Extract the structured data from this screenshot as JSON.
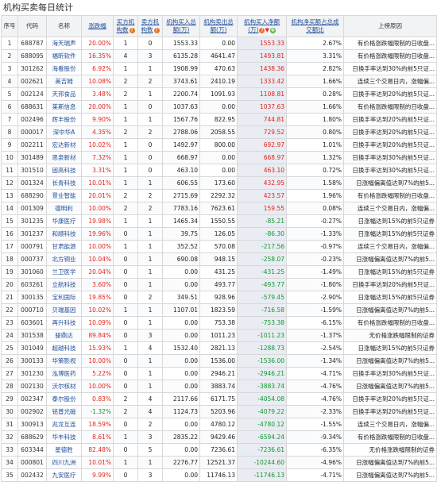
{
  "page_title": "机构买卖每日统计",
  "chart_data": {
    "type": "table",
    "columns": [
      "序号",
      "代码",
      "名称",
      "涨跌幅",
      "买方机构数",
      "卖方机构数",
      "机构买入总额(万)",
      "机构卖出总额(万)",
      "机构买入净额(万)",
      "机构净买额占总成交额比",
      "上榜原因"
    ],
    "rows": [
      [
        "1",
        "688787",
        "海天瑞声",
        "20.00%",
        "1",
        "0",
        "1553.33",
        "0.00",
        "1553.33",
        "2.67%",
        "有价格涨跌幅限制的日收盘..."
      ],
      [
        "2",
        "688095",
        "福昕软件",
        "16.35%",
        "4",
        "3",
        "6135.28",
        "4641.47",
        "1493.81",
        "3.31%",
        "有价格涨跌幅限制的日收盘..."
      ],
      [
        "3",
        "301262",
        "海看股份",
        "6.92%",
        "1",
        "1",
        "1908.99",
        "470.63",
        "1438.36",
        "2.82%",
        "日换手率达到30%的前5只证..."
      ],
      [
        "4",
        "002621",
        "美吉姆",
        "10.08%",
        "2",
        "2",
        "3743.61",
        "2410.19",
        "1333.42",
        "1.66%",
        "连续三个交易日内，涨幅偏..."
      ],
      [
        "5",
        "002124",
        "天邦食品",
        "3.48%",
        "2",
        "1",
        "2200.74",
        "1091.93",
        "1108.81",
        "0.28%",
        "日换手率达到20%的前5只证..."
      ],
      [
        "6",
        "688631",
        "莱斯信息",
        "20.00%",
        "1",
        "0",
        "1037.63",
        "0.00",
        "1037.63",
        "1.66%",
        "有价格涨跌幅限制的日收盘..."
      ],
      [
        "7",
        "002496",
        "辉丰股份",
        "9.90%",
        "1",
        "1",
        "1567.76",
        "822.95",
        "744.81",
        "1.80%",
        "日换手率达到20%的前5只证..."
      ],
      [
        "8",
        "000017",
        "深中华A",
        "4.35%",
        "2",
        "2",
        "2788.06",
        "2058.55",
        "729.52",
        "0.80%",
        "日换手率达到20%的前5只证..."
      ],
      [
        "9",
        "002211",
        "宏达新材",
        "10.02%",
        "1",
        "0",
        "1492.97",
        "800.00",
        "692.97",
        "1.01%",
        "日换手率达到20%的前5只证..."
      ],
      [
        "10",
        "301489",
        "思泉新材",
        "7.32%",
        "1",
        "0",
        "668.97",
        "0.00",
        "668.97",
        "1.32%",
        "日换手率达到30%的前5只证..."
      ],
      [
        "11",
        "301510",
        "固高科技",
        "3.31%",
        "1",
        "0",
        "463.10",
        "0.00",
        "463.10",
        "0.72%",
        "日换手率达到30%的前5只证..."
      ],
      [
        "12",
        "001324",
        "长青科技",
        "10.01%",
        "1",
        "1",
        "606.55",
        "173.60",
        "432.95",
        "1.58%",
        "日涨幅偏离值达到7%的前5..."
      ],
      [
        "13",
        "688290",
        "景业智能",
        "20.01%",
        "2",
        "2",
        "2715.69",
        "2292.32",
        "423.57",
        "1.96%",
        "有价格涨跌幅限制的日收盘..."
      ],
      [
        "14",
        "001309",
        "德明利",
        "10.00%",
        "2",
        "2",
        "7783.16",
        "7623.61",
        "159.55",
        "0.08%",
        "连续三个交易日内，涨幅偏..."
      ],
      [
        "15",
        "301235",
        "华康医疗",
        "19.98%",
        "1",
        "1",
        "1465.34",
        "1550.55",
        "-85.21",
        "-0.27%",
        "日涨幅达到15%的前5只证券"
      ],
      [
        "16",
        "301237",
        "和顺科技",
        "19.96%",
        "0",
        "1",
        "39.75",
        "126.05",
        "-86.30",
        "-1.33%",
        "日涨幅达到15%的前5只证券"
      ],
      [
        "17",
        "000791",
        "甘肃能源",
        "10.00%",
        "1",
        "1",
        "352.52",
        "570.08",
        "-217.56",
        "-0.97%",
        "连续三个交易日内，涨幅偏..."
      ],
      [
        "18",
        "000737",
        "北方铜业",
        "10.04%",
        "0",
        "1",
        "690.08",
        "948.15",
        "-258.07",
        "-0.23%",
        "日涨幅偏离值达到7%的前5..."
      ],
      [
        "19",
        "301060",
        "兰卫医学",
        "20.04%",
        "0",
        "1",
        "0.00",
        "431.25",
        "-431.25",
        "-1.49%",
        "日涨幅达到15%的前5只证券"
      ],
      [
        "20",
        "603261",
        "立航科技",
        "3.60%",
        "0",
        "1",
        "0.00",
        "493.77",
        "-493.77",
        "-1.80%",
        "日换手率达到20%的前5只证..."
      ],
      [
        "21",
        "300135",
        "宝利国际",
        "19.85%",
        "0",
        "2",
        "349.51",
        "928.96",
        "-579.45",
        "-2.90%",
        "日涨幅达到15%的前5只证券"
      ],
      [
        "22",
        "000710",
        "贝瑞基因",
        "10.02%",
        "1",
        "1",
        "1107.01",
        "1823.59",
        "-716.58",
        "-1.59%",
        "日涨幅偏离值达到7%的前5..."
      ],
      [
        "23",
        "603601",
        "再升科技",
        "10.09%",
        "0",
        "1",
        "0.00",
        "753.38",
        "-753.38",
        "-6.15%",
        "有价格涨跌幅限制的日收盘..."
      ],
      [
        "24",
        "301538",
        "骏鼎达",
        "89.84%",
        "0",
        "3",
        "0.00",
        "1011.23",
        "-1011.23",
        "-1.37%",
        "无价格涨跌幅限制的证券"
      ],
      [
        "25",
        "301049",
        "超越科技",
        "15.93%",
        "1",
        "4",
        "1532.40",
        "2821.13",
        "-1288.73",
        "-2.54%",
        "日涨幅达到15%的前5只证券"
      ],
      [
        "26",
        "300133",
        "华策影视",
        "10.00%",
        "0",
        "1",
        "0.00",
        "1536.00",
        "-1536.00",
        "-1.34%",
        "日涨幅偏离值达到7%的前5..."
      ],
      [
        "27",
        "301230",
        "泓博医药",
        "5.22%",
        "0",
        "1",
        "0.00",
        "2946.21",
        "-2946.21",
        "-4.71%",
        "日换手率达到30%的前5只证..."
      ],
      [
        "28",
        "002130",
        "沃尔核材",
        "10.00%",
        "0",
        "1",
        "0.00",
        "3883.74",
        "-3883.74",
        "-4.76%",
        "日涨幅偏离值达到7%的前5..."
      ],
      [
        "29",
        "002347",
        "泰尔股份",
        "0.83%",
        "2",
        "4",
        "2117.66",
        "6171.75",
        "-4054.08",
        "-4.76%",
        "日换手率达到20%的前5只证..."
      ],
      [
        "30",
        "002902",
        "铭普光磁",
        "-1.32%",
        "2",
        "4",
        "1124.73",
        "5203.96",
        "-4079.22",
        "-2.33%",
        "日换手率达到20%的前5只证..."
      ],
      [
        "31",
        "300913",
        "兆龙互连",
        "18.59%",
        "0",
        "2",
        "0.00",
        "4780.12",
        "-4780.12",
        "-1.55%",
        "连续三个交易日内，涨幅偏..."
      ],
      [
        "32",
        "688629",
        "华丰科技",
        "8.61%",
        "1",
        "3",
        "2835.22",
        "9429.46",
        "-6594.24",
        "-9.34%",
        "有价格涨跌幅限制的日收盘..."
      ],
      [
        "33",
        "603344",
        "星德胜",
        "82.48%",
        "0",
        "5",
        "0.00",
        "7236.61",
        "-7236.61",
        "-6.35%",
        "无价格涨跌幅限制的证券"
      ],
      [
        "34",
        "000801",
        "四川九洲",
        "10.01%",
        "1",
        "1",
        "2276.77",
        "12521.37",
        "-10244.60",
        "-4.96%",
        "日涨幅偏离值达到7%的前5..."
      ],
      [
        "35",
        "002432",
        "九安医疗",
        "9.99%",
        "0",
        "3",
        "0.00",
        "11746.13",
        "-11746.13",
        "-4.71%",
        "日涨幅偏离值达到7%的前5..."
      ]
    ]
  },
  "colors": {
    "up": "#e2231a",
    "down": "#119933",
    "link": "#1f4e9a",
    "highlight_col": "#e9ecf2"
  },
  "icons": {
    "sort": "sort-desc-icon",
    "badge_buy": "help-icon",
    "badge_sell": "help-icon",
    "net_buy_extra": "clover-icon"
  }
}
